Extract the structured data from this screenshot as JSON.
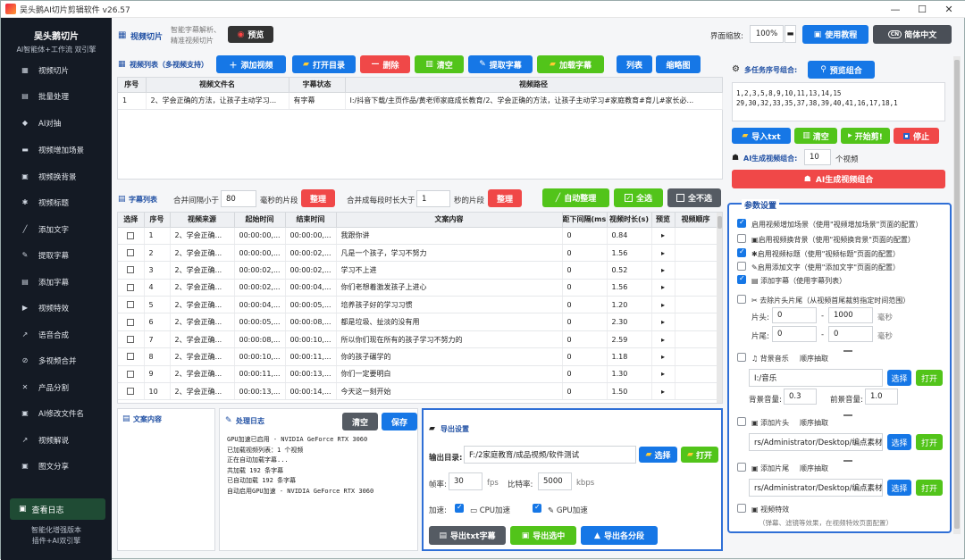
{
  "window": {
    "title": "吴头鹅AI切片剪辑软件 v26.57",
    "min": "—",
    "max": "☐",
    "close": "✕"
  },
  "sidebar": {
    "brand": "吴头鹅切片",
    "brand_sub": "AI智能体+工作流 双引擎",
    "items": [
      {
        "label": "视频切片",
        "icon": "▦"
      },
      {
        "label": "批量处理",
        "icon": "▤"
      },
      {
        "label": "AI对抽",
        "icon": "◆"
      },
      {
        "label": "视频增加场景",
        "icon": "▬"
      },
      {
        "label": "视频换背景",
        "icon": "▣"
      },
      {
        "label": "视频标题",
        "icon": "✱"
      },
      {
        "label": "添加文字",
        "icon": "╱"
      },
      {
        "label": "提取字幕",
        "icon": "✎"
      },
      {
        "label": "添加字幕",
        "icon": "▤"
      },
      {
        "label": "视频特效",
        "icon": "▶"
      },
      {
        "label": "语音合成",
        "icon": "↗"
      },
      {
        "label": "多视频合并",
        "icon": "⊘"
      },
      {
        "label": "产品分割",
        "icon": "✕"
      },
      {
        "label": "AI修改文件名",
        "icon": "▣"
      },
      {
        "label": "视频解说",
        "icon": "↗"
      },
      {
        "label": "图文分享",
        "icon": "▣"
      }
    ],
    "log_button": "查看日志",
    "footer1": "智能化增强版本",
    "footer2": "插件+AI双引擎"
  },
  "header": {
    "page_title": "视频切片",
    "desc1": "智能字幕解析、",
    "desc2": "精准视频切片",
    "preview": "预览",
    "zoom_label": "界面缩放:",
    "zoom_value": "100%",
    "tutorial": "使用教程",
    "lang": "简体中文",
    "lang_badge": "CN"
  },
  "video_list": {
    "title": "视频列表（多视频支持）",
    "buttons": {
      "add": "添加视频",
      "open_dir": "打开目录",
      "delete": "删除",
      "clear": "清空",
      "extract": "提取字幕",
      "load": "加载字幕",
      "list": "列表",
      "thumb": "缩略图"
    },
    "columns": [
      "序号",
      "视频文件名",
      "字幕状态",
      "视频路径"
    ],
    "rows": [
      [
        "1",
        "2、学会正确的方法，让孩子主动学习...",
        "有字幕",
        "I:/抖音下载/主页作品/黄老师家庭成长教育/2、学会正确的方法，让孩子主动学习#家庭教育#育儿#家长必..."
      ]
    ]
  },
  "multi": {
    "title": "多任务序号组合:",
    "preview_btn": "预览组合",
    "numbers_line1": "1,2,3,5,8,9,10,11,13,14,15",
    "numbers_line2": "29,30,32,33,35,37,38,39,40,41,16,17,18,1",
    "import": "导入txt",
    "clear": "清空",
    "start": "开始剪!",
    "stop": "停止",
    "ai_label": "AI生成视频组合:",
    "ai_count": "10",
    "ai_unit": "个视频",
    "ai_btn": "AI生成视频组合"
  },
  "subtitle_list": {
    "title": "字幕列表",
    "merge_label": "合并间隔小于",
    "merge_value": "80",
    "merge_unit": "毫秒的片段",
    "organize": "整理",
    "merge2_label": "合并成每段时长大于",
    "merge2_value": "1",
    "merge2_unit": "秒的片段",
    "organize2": "整理",
    "auto": "自动整理",
    "select_all": "全选",
    "select_none": "全不选",
    "columns": [
      "选择",
      "序号",
      "视频来源",
      "起始时间",
      "结束时间",
      "文案内容",
      "距下间隔(ms)",
      "视频时长(s)",
      "预览",
      "视频顺序"
    ],
    "rows": [
      [
        "1",
        "2、学会正确...",
        "00:00:00,...",
        "00:00:00,...",
        "我跟你讲",
        "0",
        "0.84"
      ],
      [
        "2",
        "2、学会正确...",
        "00:00:00,...",
        "00:00:02,...",
        "凡是一个孩子，学习不努力",
        "0",
        "1.56"
      ],
      [
        "3",
        "2、学会正确...",
        "00:00:02,...",
        "00:00:02,...",
        "学习不上进",
        "0",
        "0.52"
      ],
      [
        "4",
        "2、学会正确...",
        "00:00:02,...",
        "00:00:04,...",
        "你们老想着激发孩子上进心",
        "0",
        "1.56"
      ],
      [
        "5",
        "2、学会正确...",
        "00:00:04,...",
        "00:00:05,...",
        "培养孩子好的学习习惯",
        "0",
        "1.20"
      ],
      [
        "6",
        "2、学会正确...",
        "00:00:05,...",
        "00:00:08,...",
        "都是垃圾、扯淡的没有用",
        "0",
        "2.30"
      ],
      [
        "7",
        "2、学会正确...",
        "00:00:08,...",
        "00:00:10,...",
        "所以你们现在所有的孩子学习不努力的",
        "0",
        "2.59"
      ],
      [
        "8",
        "2、学会正确...",
        "00:00:10,...",
        "00:00:11,...",
        "你的孩子碾学的",
        "0",
        "1.18"
      ],
      [
        "9",
        "2、学会正确...",
        "00:00:11,...",
        "00:00:13,...",
        "你们一定要明白",
        "0",
        "1.30"
      ],
      [
        "10",
        "2、学会正确...",
        "00:00:13,...",
        "00:00:14,...",
        "今天这一刻开始",
        "0",
        "1.50"
      ]
    ],
    "play": "▸"
  },
  "text_panel": {
    "title": "文案内容"
  },
  "log_panel": {
    "title": "处理日志",
    "clear": "清空",
    "save": "保存",
    "lines": [
      "GPU加速已启用 - NVIDIA GeForce RTX 3060",
      "已加载视频列表：1 个视频",
      "正在自动加载字幕...",
      "共加载 192 条字幕",
      "已自动加载 192 条字幕",
      "自动启用GPU加速 - NVIDIA GeForce RTX 3060"
    ]
  },
  "export": {
    "title": "导出设置",
    "dir_label": "输出目录:",
    "dir_value": "F:/2家庭教育/成品视频/软件测试",
    "choose": "选择",
    "open": "打开",
    "fps_label": "帧率:",
    "fps_value": "30",
    "fps_unit": "fps",
    "bitrate_label": "比特率:",
    "bitrate_value": "5000",
    "bitrate_unit": "kbps",
    "accel_label": "加速:",
    "cpu": "CPU加速",
    "gpu": "GPU加速",
    "btn_txt": "导出txt字幕",
    "btn_sel": "导出选中",
    "btn_all": "导出各分段"
  },
  "params": {
    "title": "参数设置",
    "opt1": "启用视频增加场景（使用\"视频增加场景\"页面的配置）",
    "opt2": "启用视频换背景（使用\"视频换背景\"页面的配置）",
    "opt3": "启用视频标题（使用\"视频标题\"页面的配置）",
    "opt4": "启用添加文字（使用\"添加文字\"页面的配置）",
    "opt5": "添加字幕（使用字幕列表）",
    "trim": "去除片头片尾（从视频首尾裁剪指定时间范围）",
    "head_label": "片头:",
    "head_from": "0",
    "head_to": "1000",
    "tail_label": "片尾:",
    "tail_from": "0",
    "tail_to": "0",
    "dash": "-",
    "ms": "毫秒",
    "bgm": "背景音乐",
    "order": "顺序抽取",
    "bgm_path": "I:/音乐",
    "choose": "选择",
    "open": "打开",
    "bgm_vol_label": "背景音量:",
    "bgm_vol": "0.3",
    "fg_vol_label": "前景音量:",
    "fg_vol": "1.0",
    "intro": "添加片头",
    "intro_path": "rs/Administrator/Desktop/编点素材",
    "outro": "添加片尾",
    "outro_path": "rs/Administrator/Desktop/编点素材",
    "fx": "视频特效",
    "fx_desc": "（弹幕、滤镜等效果，在视频特效页面配置）"
  }
}
